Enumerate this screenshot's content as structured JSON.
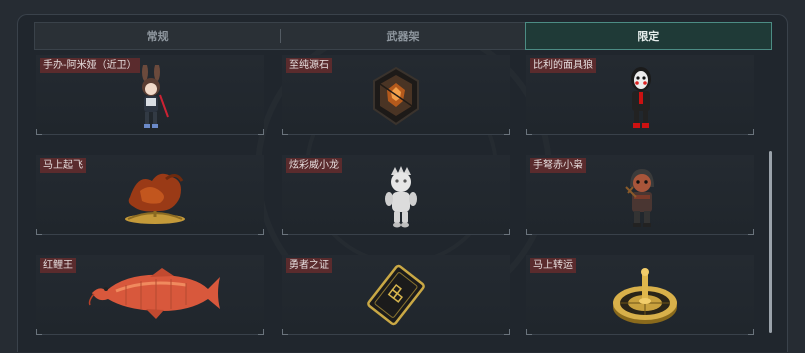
{
  "tabs": [
    {
      "label": "常规",
      "active": false
    },
    {
      "label": "武器架",
      "active": false
    },
    {
      "label": "限定",
      "active": true
    }
  ],
  "items": [
    {
      "name": "手办-阿米娅（近卫）",
      "icon": "amiya-figure-icon"
    },
    {
      "name": "至纯源石",
      "icon": "originium-crystal-icon"
    },
    {
      "name": "比利的面具狼",
      "icon": "billy-mask-figure-icon"
    },
    {
      "name": "马上起飞",
      "icon": "flying-horse-statue-icon"
    },
    {
      "name": "炫彩威小龙",
      "icon": "white-dragon-figure-icon"
    },
    {
      "name": "手弩赤小枭",
      "icon": "crossbow-hooded-figure-icon"
    },
    {
      "name": "红鲤王",
      "icon": "red-carp-icon"
    },
    {
      "name": "勇者之证",
      "icon": "hero-card-icon"
    },
    {
      "name": "马上转运",
      "icon": "golden-wheel-icon"
    }
  ],
  "colors": {
    "background": "#262c33",
    "active_tab_border": "#4c8c84",
    "label_bg": "#5a2b2d"
  }
}
